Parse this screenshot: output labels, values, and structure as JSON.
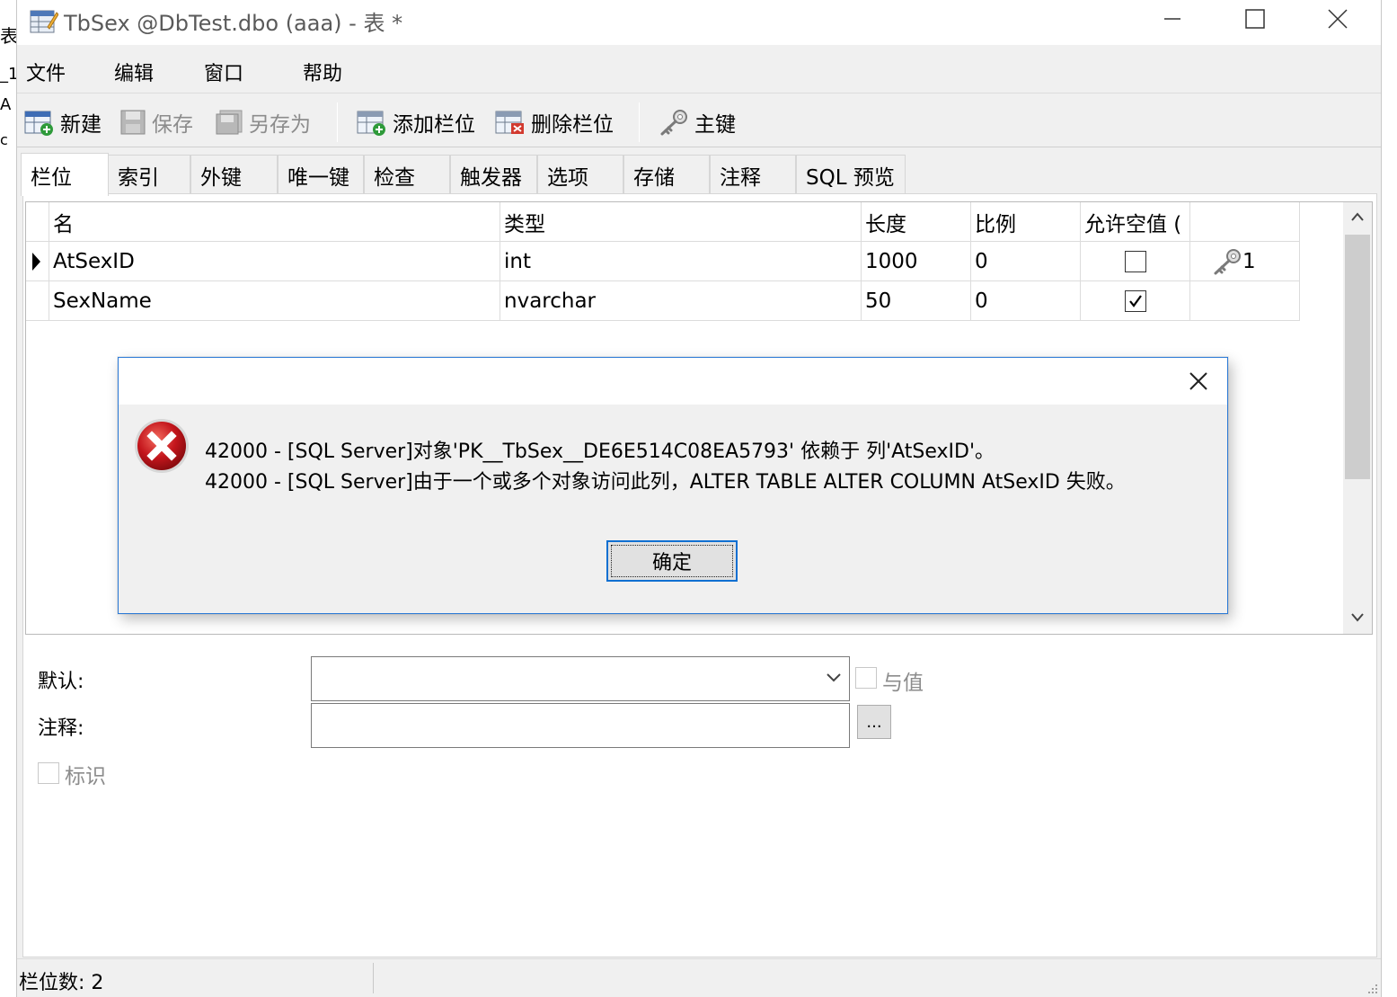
{
  "window": {
    "title": "TbSex @DbTest.dbo (aaa) - 表 *"
  },
  "menu": [
    "文件",
    "编辑",
    "窗口",
    "帮助"
  ],
  "toolbar": {
    "new": "新建",
    "save": "保存",
    "save_as": "另存为",
    "add_field": "添加栏位",
    "delete_field": "删除栏位",
    "primary_key": "主键"
  },
  "tabs": [
    "栏位",
    "索引",
    "外键",
    "唯一键",
    "检查",
    "触发器",
    "选项",
    "存储",
    "注释",
    "SQL 预览"
  ],
  "grid": {
    "headers": [
      "名",
      "类型",
      "长度",
      "比例",
      "允许空值 (",
      ""
    ],
    "rows": [
      {
        "name": "AtSexID",
        "type": "int",
        "length": "1000",
        "scale": "0",
        "nullable": false,
        "key": "1"
      },
      {
        "name": "SexName",
        "type": "nvarchar",
        "length": "50",
        "scale": "0",
        "nullable": true,
        "key": ""
      }
    ]
  },
  "form": {
    "default_label": "默认:",
    "comment_label": "注释:",
    "with_value": "与值",
    "ellipsis": "...",
    "identity": "标识"
  },
  "status": {
    "field_count": "栏位数: 2"
  },
  "dialog": {
    "line1": "42000 - [SQL Server]对象'PK__TbSex__DE6E514C08EA5793' 依赖于 列'AtSexID'。",
    "line2": "42000 - [SQL Server]由于一个或多个对象访问此列，ALTER TABLE ALTER COLUMN AtSexID 失败。",
    "ok": "确定"
  },
  "background_strip": [
    "表",
    "_1",
    "A",
    "c"
  ],
  "colors": {
    "accent": "#0f6fd1",
    "error": "#c4161c"
  }
}
